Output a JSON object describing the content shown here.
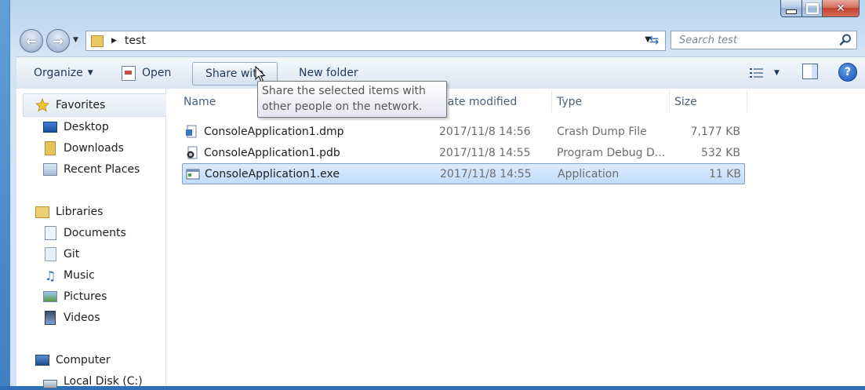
{
  "window": {
    "caption_buttons": {
      "minimize": "minimize-icon",
      "maximize": "maximize-icon",
      "close": "close-icon"
    }
  },
  "address_bar": {
    "breadcrumb": "test"
  },
  "search": {
    "placeholder": "Search test"
  },
  "toolbar": {
    "organize_label": "Organize",
    "open_label": "Open",
    "share_label": "Share with",
    "new_folder_label": "New folder"
  },
  "tooltip": {
    "text": "Share the selected items with other people on the network."
  },
  "navigation": {
    "favorites": {
      "label": "Favorites",
      "items": [
        {
          "label": "Desktop",
          "icon": "desktop-icon"
        },
        {
          "label": "Downloads",
          "icon": "downloads-folder-icon"
        },
        {
          "label": "Recent Places",
          "icon": "recent-places-icon"
        }
      ]
    },
    "libraries": {
      "label": "Libraries",
      "items": [
        {
          "label": "Documents",
          "icon": "documents-icon"
        },
        {
          "label": "Git",
          "icon": "git-library-icon"
        },
        {
          "label": "Music",
          "icon": "music-icon"
        },
        {
          "label": "Pictures",
          "icon": "pictures-icon"
        },
        {
          "label": "Videos",
          "icon": "videos-icon"
        }
      ]
    },
    "computer": {
      "label": "Computer",
      "items": [
        {
          "label": "Local Disk (C:)",
          "icon": "drive-icon"
        }
      ]
    }
  },
  "file_list": {
    "columns": {
      "name": "Name",
      "date": "Date modified",
      "type": "Type",
      "size": "Size"
    },
    "rows": [
      {
        "name": "ConsoleApplication1.dmp",
        "date": "2017/11/8 14:56",
        "type": "Crash Dump File",
        "size": "7,177 KB",
        "icon": "dump-file-icon",
        "selected": false
      },
      {
        "name": "ConsoleApplication1.pdb",
        "date": "2017/11/8 14:55",
        "type": "Program Debug D...",
        "size": "532 KB",
        "icon": "debug-file-icon",
        "selected": false
      },
      {
        "name": "ConsoleApplication1.exe",
        "date": "2017/11/8 14:55",
        "type": "Application",
        "size": "11 KB",
        "icon": "application-icon",
        "selected": true
      }
    ]
  },
  "colors": {
    "selection_fill": "#c9e0fb",
    "selection_border": "#7da2ce",
    "link_text": "#1e395b"
  }
}
